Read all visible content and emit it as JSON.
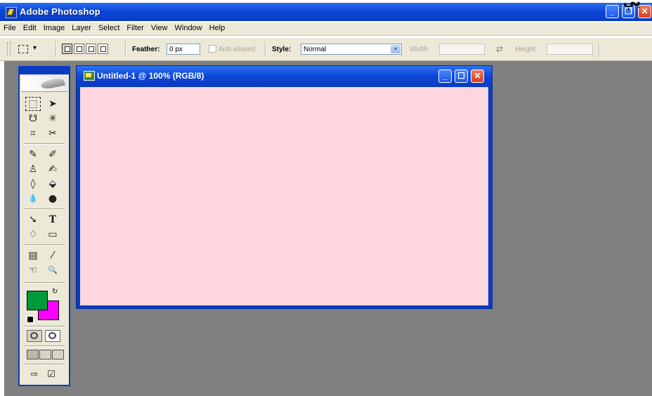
{
  "app": {
    "title": "Adobe Photoshop",
    "title_extra_glyph": "يې",
    "window_controls": {
      "minimize": "_",
      "restore": "❐",
      "close": "✕"
    }
  },
  "menubar": {
    "items": [
      "File",
      "Edit",
      "Image",
      "Layer",
      "Select",
      "Filter",
      "View",
      "Window",
      "Help"
    ]
  },
  "options_bar": {
    "dropdown_glyph": "▾",
    "feather_label": "Feather:",
    "feather_value": "0 px",
    "antialiased_label": "Anti-aliased",
    "style_label": "Style:",
    "style_value": "Normal",
    "width_label": "Width:",
    "width_value": "",
    "height_label": "Height:",
    "height_value": "",
    "swap_glyph": "⇄"
  },
  "toolbox": {
    "tools": [
      {
        "name": "rect-marquee-tool",
        "glyph": "⬚",
        "selected": true
      },
      {
        "name": "move-tool",
        "glyph": "➤"
      },
      {
        "name": "lasso-tool",
        "glyph": "☋"
      },
      {
        "name": "magic-wand-tool",
        "glyph": "✳"
      },
      {
        "name": "crop-tool",
        "glyph": "⌗"
      },
      {
        "name": "slice-tool",
        "glyph": "✂"
      },
      {
        "name": "healing-brush-tool",
        "glyph": "✎"
      },
      {
        "name": "brush-tool",
        "glyph": "✐"
      },
      {
        "name": "clone-stamp-tool",
        "glyph": "♙"
      },
      {
        "name": "history-brush-tool",
        "glyph": "✍"
      },
      {
        "name": "eraser-tool",
        "glyph": "◊"
      },
      {
        "name": "paint-bucket-tool",
        "glyph": "⬙"
      },
      {
        "name": "blur-tool",
        "glyph": "💧"
      },
      {
        "name": "dodge-tool",
        "glyph": "●"
      },
      {
        "name": "path-selection-tool",
        "glyph": "➘"
      },
      {
        "name": "type-tool",
        "glyph": "T"
      },
      {
        "name": "pen-tool",
        "glyph": "♢"
      },
      {
        "name": "rectangle-tool",
        "glyph": "▭"
      },
      {
        "name": "notes-tool",
        "glyph": "▤"
      },
      {
        "name": "eyedropper-tool",
        "glyph": "⁄"
      },
      {
        "name": "hand-tool",
        "glyph": "☜"
      },
      {
        "name": "zoom-tool",
        "glyph": "🔍"
      }
    ],
    "foreground_color": "#009a3a",
    "background_color": "#ff00ff"
  },
  "document": {
    "title": "Untitled-1 @ 100% (RGB/8)",
    "canvas_color": "#fed6df"
  }
}
